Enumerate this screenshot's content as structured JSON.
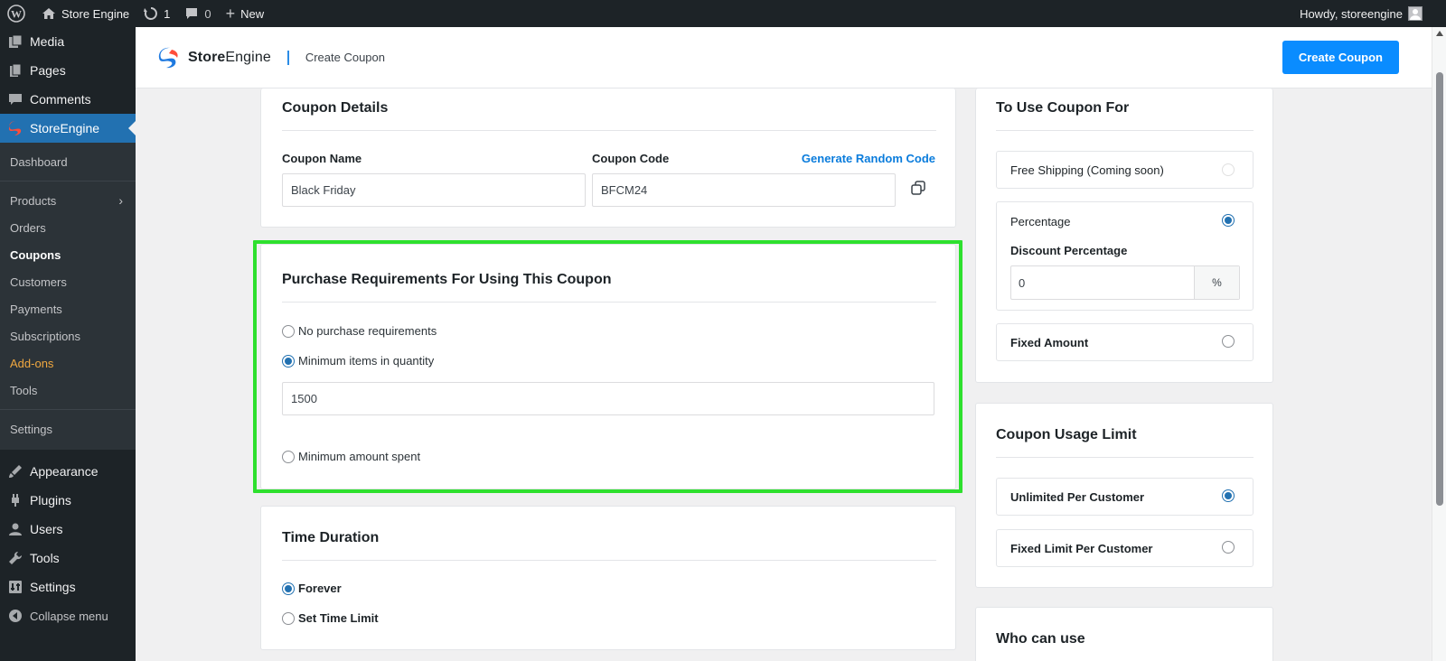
{
  "admin_bar": {
    "site_name": "Store Engine",
    "updates_count": "1",
    "comments_count": "0",
    "new_label": "New",
    "howdy": "Howdy, storeengine"
  },
  "sidebar": {
    "top_items": [
      {
        "label": "Media",
        "icon": "media-icon"
      },
      {
        "label": "Pages",
        "icon": "pages-icon"
      },
      {
        "label": "Comments",
        "icon": "comments-icon"
      }
    ],
    "active_item": {
      "label": "StoreEngine",
      "icon": "storeengine-icon"
    },
    "submenu": [
      "Dashboard",
      "Products",
      "Orders",
      "Coupons",
      "Customers",
      "Payments",
      "Subscriptions",
      "Add-ons",
      "Tools",
      "Settings"
    ],
    "lower_items": [
      {
        "label": "Appearance",
        "icon": "appearance-icon"
      },
      {
        "label": "Plugins",
        "icon": "plugins-icon"
      },
      {
        "label": "Users",
        "icon": "users-icon"
      },
      {
        "label": "Tools",
        "icon": "tools-icon"
      },
      {
        "label": "Settings",
        "icon": "settings-icon"
      }
    ],
    "collapse_label": "Collapse menu"
  },
  "header": {
    "brand_bold": "Store",
    "brand_regular": "Engine",
    "title": "Create Coupon",
    "create_button": "Create Coupon"
  },
  "coupon_details": {
    "title": "Coupon Details",
    "name_label": "Coupon Name",
    "name_value": "Black Friday",
    "code_label": "Coupon Code",
    "generate_link": "Generate Random Code",
    "code_value": "BFCM24"
  },
  "purchase_requirements": {
    "title": "Purchase Requirements For Using This Coupon",
    "option_none": "No purchase requirements",
    "option_min_items": "Minimum items in quantity",
    "min_items_value": "1500",
    "option_min_amount": "Minimum amount spent",
    "selected": "min_items"
  },
  "time_duration": {
    "title": "Time Duration",
    "option_forever": "Forever",
    "option_limit": "Set Time Limit",
    "selected": "forever"
  },
  "use_coupon_for": {
    "title": "To Use Coupon For",
    "free_shipping": "Free Shipping (Coming soon)",
    "percentage": "Percentage",
    "discount_label": "Discount Percentage",
    "discount_value": "0",
    "percent_suffix": "%",
    "fixed_amount": "Fixed Amount",
    "selected": "percentage"
  },
  "usage_limit": {
    "title": "Coupon Usage Limit",
    "unlimited": "Unlimited Per Customer",
    "fixed_limit": "Fixed Limit Per Customer",
    "selected": "unlimited"
  },
  "who_can_use": {
    "title": "Who can use"
  },
  "colors": {
    "accent": "#0a8cff",
    "highlight": "#2ee02e",
    "sidebar_bg": "#1d2327",
    "active_menu": "#2271b1"
  }
}
